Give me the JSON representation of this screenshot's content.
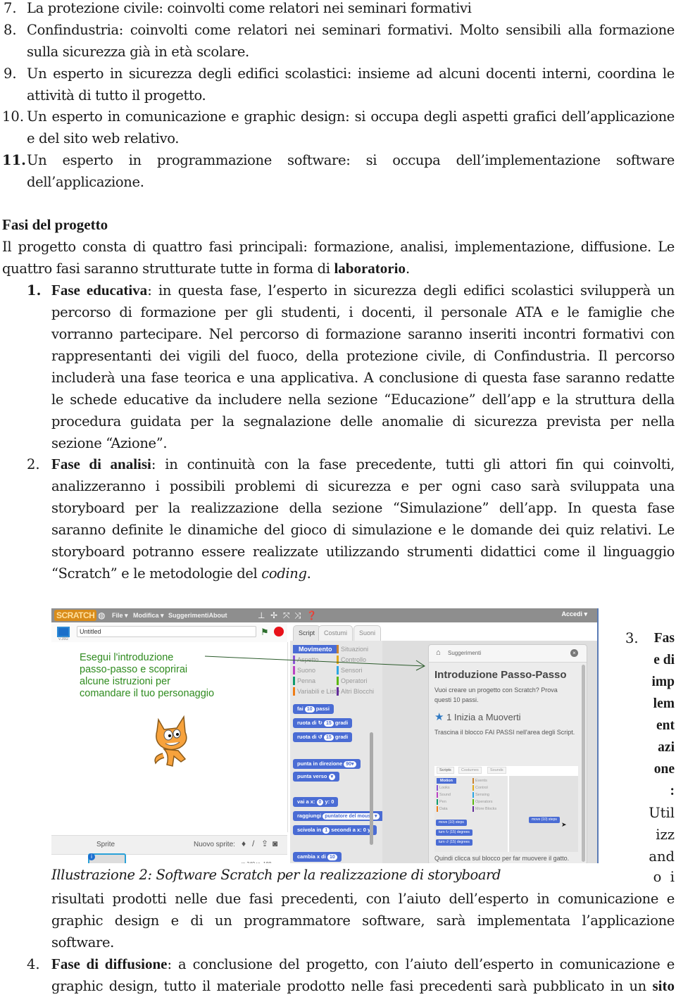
{
  "list_top": [
    {
      "num": "7.",
      "lines": [
        "La protezione civile: coinvolti come relatori nei seminari formativi"
      ]
    },
    {
      "num": "8.",
      "lines": [
        "Confindustria: coinvolti come relatori nei seminari formativi. Molto sensibili alla formazione",
        "sulla sicurezza già in età scolare."
      ]
    },
    {
      "num": "9.",
      "lines": [
        "Un esperto in sicurezza degli edifici scolastici: insieme ad alcuni docenti interni, coordina le",
        "attività di tutto il progetto."
      ]
    },
    {
      "num": "10.",
      "lines": [
        "Un esperto in comunicazione e graphic design: si occupa degli aspetti grafici dell’applicazione",
        "e del sito web relativo."
      ]
    },
    {
      "num": "11.",
      "lines": [
        "Un esperto in programmazione software: si occupa dell’implementazione software",
        "dell’applicazione."
      ]
    }
  ],
  "section": {
    "heading": "Fasi del progetto",
    "intro_line1": "Il progetto consta di quattro fasi principali: formazione, analisi, implementazione, diffusione. Le",
    "intro_line2_text": "quattro fasi saranno strutturate tutte in forma di ",
    "intro_line2_bold": "laboratorio",
    "intro_line2_end": "."
  },
  "phases": [
    {
      "num": "1.",
      "title": "Fase educativa",
      "first_line": ": in questa fase, l’esperto in sicurezza degli edifici scolastici svilupperà un",
      "lines": [
        "percorso di formazione per gli studenti, i docenti, il personale ATA e le famiglie che",
        "vorranno partecipare. Nel percorso di formazione saranno inseriti incontri formativi con",
        "rappresentanti dei vigili del fuoco, della protezione civile, di Confindustria. Il percorso",
        "includerà una fase teorica e una applicativa. A conclusione di questa fase saranno redatte",
        "le schede educative da includere nella sezione “Educazione” dell’app e la struttura della",
        "procedura guidata per la segnalazione delle anomalie di sicurezza prevista per nella",
        "sezione “Azione”."
      ]
    },
    {
      "num": "2.",
      "title": "Fase di analisi",
      "first_line": ": in continuità con la fase precedente, tutti gli attori fin qui coinvolti,",
      "lines": [
        "analizzeranno i possibili problemi di sicurezza e per ogni caso sarà sviluppata una",
        "storyboard per la realizzazione della sezione “Simulazione” dell’app. In questa fase",
        "saranno definite le dinamiche del gioco di simulazione e le domande dei quiz relativi. Le",
        "storyboard potranno essere realizzate utilizzando strumenti didattici come il linguaggio"
      ],
      "last_line_text": "“Scratch” e le metodologie del ",
      "last_line_italic": "coding",
      "last_line_end": "."
    },
    {
      "num": "3.",
      "title_fragments": [
        "Fas",
        "e di",
        "imp",
        "lem",
        "ent",
        "azi",
        "one",
        ":"
      ],
      "text_fragments": [
        "Util",
        "izz",
        "and",
        "o  i"
      ],
      "lines": [
        "risultati prodotti nelle due fasi precedenti, con l’aiuto dell’esperto in comunicazione e",
        "graphic design e di un programmatore software, sarà implementata l’applicazione",
        "software."
      ]
    },
    {
      "num": "4.",
      "title": "Fase di diffusione",
      "first_line": ": a conclusione del progetto, con l’aiuto dell’esperto in comunicazione e",
      "line2_text": "graphic design, tutto il materiale prodotto nelle fasi precedenti sarà pubblicato in un ",
      "line2_bold": "sito"
    }
  ],
  "figure": {
    "caption": "Illustrazione 2: Software Scratch per la realizzazione di storyboard",
    "scratch": {
      "logo": "SCRATCH",
      "menu": [
        "File ▾",
        "Modifica ▾",
        "SuggerimentiAbout"
      ],
      "login": "Accedi ▾",
      "version": "v.392",
      "project_title": "Untitled",
      "stage_text": "Esegui l'introduzione\npasso-passo e scoprirai\nalcune istruzioni per\ncomandare il tuo personaggio",
      "coords": "x: 240  y: -180",
      "sprite_label": "Sprite",
      "new_sprite_label": "Nuovo sprite:",
      "tabs": [
        "Script",
        "Costumi",
        "Suoni"
      ],
      "categories": [
        {
          "label": "Movimento",
          "color": "#4a6cd4",
          "selected": true
        },
        {
          "label": "Situazioni",
          "color": "#c88330"
        },
        {
          "label": "Aspetto",
          "color": "#8a55d7"
        },
        {
          "label": "Controllo",
          "color": "#e1a91a"
        },
        {
          "label": "Suono",
          "color": "#bb42c3"
        },
        {
          "label": "Sensori",
          "color": "#2ca5e2"
        },
        {
          "label": "Penna",
          "color": "#0e9a6c"
        },
        {
          "label": "Operatori",
          "color": "#5cb712"
        },
        {
          "label": "Variabili e Liste",
          "color": "#ee7d16"
        },
        {
          "label": "Altri Blocchi",
          "color": "#632d99"
        }
      ],
      "blocks": [
        {
          "pre": "fai",
          "val": "10",
          "post": "passi"
        },
        {
          "pre": "ruota di ↻",
          "val": "15",
          "post": "gradi"
        },
        {
          "pre": "ruota di ↺",
          "val": "15",
          "post": "gradi"
        },
        {
          "pre": "punta in direzione",
          "val": "90▾",
          "post": ""
        },
        {
          "pre": "punta verso",
          "val": "▾",
          "post": ""
        },
        {
          "pre": "vai a x:",
          "val": "0",
          "post": "y: 0"
        },
        {
          "pre": "raggiungi",
          "val": "puntatore del mouse ▾",
          "post": ""
        },
        {
          "pre": "scivola in",
          "val": "1",
          "post": "secondi a x: 0 y:"
        },
        {
          "pre": "cambia x di",
          "val": "10",
          "post": ""
        }
      ],
      "tips": {
        "header": "Suggerimenti",
        "title": "Introduzione Passo-Passo",
        "intro": "Vuoi creare un progetto con Scratch? Prova questi 10 passi.",
        "step_title": "1 Inizia a Muoverti",
        "step_text": "Trascina il blocco FAI PASSI nell'area degli Script.",
        "footer": "Quindi clicca sul blocco per far muovere il gatto.",
        "mini": {
          "tabs": [
            "Scripts",
            "Costumes",
            "Sounds"
          ],
          "categories": [
            {
              "label": "Motion",
              "color": "#4a6cd4",
              "selected": true
            },
            {
              "label": "Events",
              "color": "#c88330"
            },
            {
              "label": "Looks",
              "color": "#8a55d7"
            },
            {
              "label": "Control",
              "color": "#e1a91a"
            },
            {
              "label": "Sound",
              "color": "#bb42c3"
            },
            {
              "label": "Sensing",
              "color": "#2ca5e2"
            },
            {
              "label": "Pen",
              "color": "#0e9a6c"
            },
            {
              "label": "Operators",
              "color": "#5cb712"
            },
            {
              "label": "Data",
              "color": "#ee7d16"
            },
            {
              "label": "More Blocks",
              "color": "#632d99"
            }
          ],
          "blocks": [
            "move (10) steps",
            "turn ↻ (15) degrees",
            "turn ↺ (15) degrees"
          ],
          "dragged_block": "move (10) steps"
        }
      }
    }
  }
}
